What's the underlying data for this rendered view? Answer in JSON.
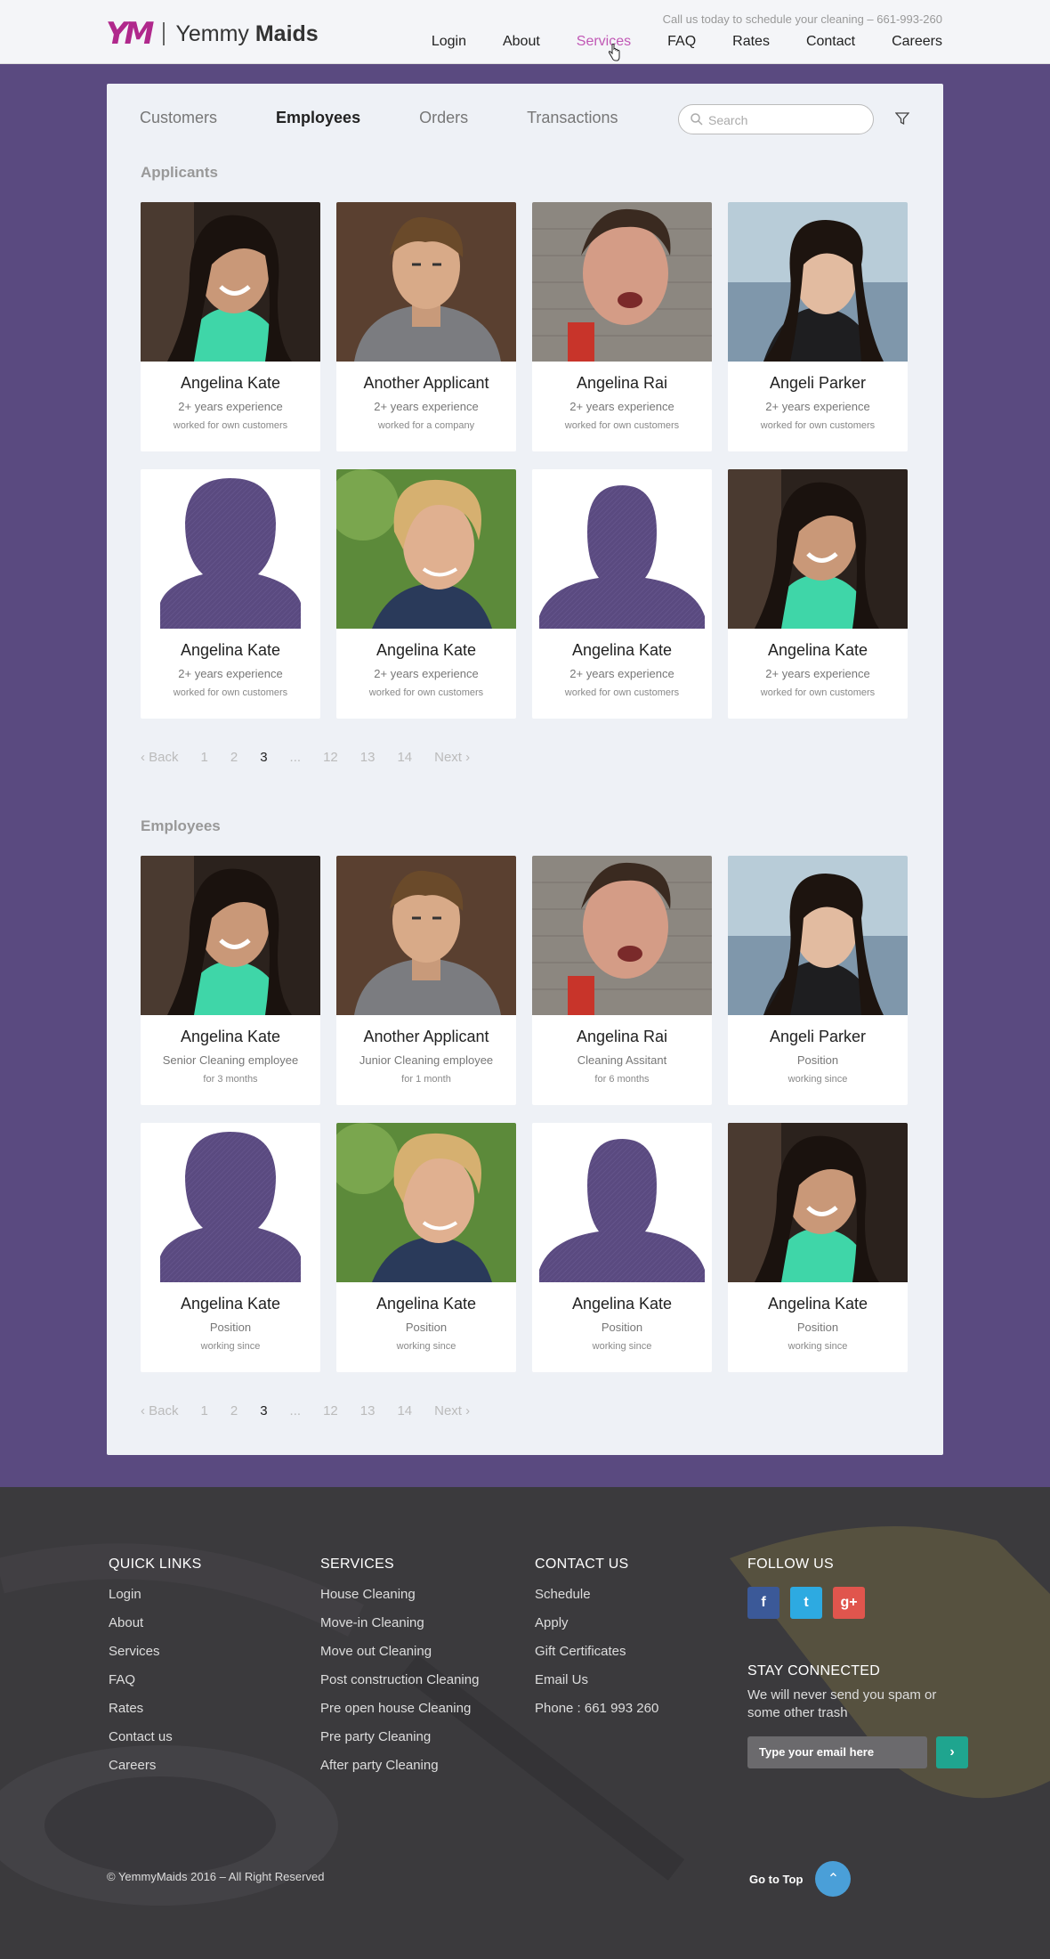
{
  "header": {
    "logo_mark": "YM",
    "logo_text_light": "Yemmy",
    "logo_text_bold": "Maids",
    "callus": "Call us today to schedule your cleaning – 661-993-260",
    "nav": [
      "Login",
      "About",
      "Services",
      "FAQ",
      "Rates",
      "Contact",
      "Careers"
    ],
    "active_nav": "Services"
  },
  "tabs": [
    "Customers",
    "Employees",
    "Orders",
    "Transactions"
  ],
  "active_tab": "Employees",
  "search": {
    "placeholder": "Search"
  },
  "applicants": {
    "title": "Applicants",
    "cards": [
      {
        "name": "Angelina Kate",
        "line1": "2+ years experience",
        "line2": "worked for own customers",
        "photo": "woman-smiling-green-top"
      },
      {
        "name": "Another Applicant",
        "line1": "2+ years experience",
        "line2": "worked for a company",
        "photo": "young-man-grey-hoodie"
      },
      {
        "name": "Angelina Rai",
        "line1": "2+ years experience",
        "line2": "worked for own customers",
        "photo": "woman-brick-wall"
      },
      {
        "name": "Angeli Parker",
        "line1": "2+ years experience",
        "line2": "worked for own customers",
        "photo": "woman-seaside"
      },
      {
        "name": "Angelina Kate",
        "line1": "2+ years experience",
        "line2": "worked for own customers",
        "photo": "female-silhouette"
      },
      {
        "name": "Angelina Kate",
        "line1": "2+ years experience",
        "line2": "worked for own customers",
        "photo": "blond-teen-boy"
      },
      {
        "name": "Angelina Kate",
        "line1": "2+ years experience",
        "line2": "worked for own customers",
        "photo": "male-silhouette"
      },
      {
        "name": "Angelina Kate",
        "line1": "2+ years experience",
        "line2": "worked for own customers",
        "photo": "woman-smiling-green-top"
      }
    ],
    "pager": {
      "back": "Back",
      "pages": [
        "1",
        "2",
        "3",
        "...",
        "12",
        "13",
        "14"
      ],
      "current": "3",
      "next": "Next"
    }
  },
  "employees": {
    "title": "Employees",
    "cards": [
      {
        "name": "Angelina Kate",
        "line1": "Senior Cleaning employee",
        "line2": "for 3 months",
        "photo": "woman-smiling-green-top"
      },
      {
        "name": "Another Applicant",
        "line1": "Junior Cleaning employee",
        "line2": "for 1 month",
        "photo": "young-man-grey-hoodie"
      },
      {
        "name": "Angelina Rai",
        "line1": "Cleaning Assitant",
        "line2": "for 6 months",
        "photo": "woman-brick-wall"
      },
      {
        "name": "Angeli Parker",
        "line1": "Position",
        "line2": "working since",
        "photo": "woman-seaside"
      },
      {
        "name": "Angelina Kate",
        "line1": "Position",
        "line2": "working since",
        "photo": "female-silhouette"
      },
      {
        "name": "Angelina Kate",
        "line1": "Position",
        "line2": "working since",
        "photo": "blond-teen-boy"
      },
      {
        "name": "Angelina Kate",
        "line1": "Position",
        "line2": "working since",
        "photo": "male-silhouette"
      },
      {
        "name": "Angelina Kate",
        "line1": "Position",
        "line2": "working since",
        "photo": "woman-smiling-green-top"
      }
    ],
    "pager": {
      "back": "Back",
      "pages": [
        "1",
        "2",
        "3",
        "...",
        "12",
        "13",
        "14"
      ],
      "current": "3",
      "next": "Next"
    }
  },
  "footer": {
    "quick_links": {
      "title": "QUICK LINKS",
      "items": [
        "Login",
        "About",
        "Services",
        "FAQ",
        "Rates",
        "Contact us",
        "Careers"
      ]
    },
    "services": {
      "title": "SERVICES",
      "items": [
        "House Cleaning",
        "Move-in Cleaning",
        "Move out Cleaning",
        "Post construction Cleaning",
        "Pre open house Cleaning",
        "Pre party Cleaning",
        "After party Cleaning"
      ]
    },
    "contact": {
      "title": "CONTACT US",
      "items": [
        "Schedule",
        "Apply",
        "Gift Certificates",
        "Email Us",
        "Phone : 661 993 260"
      ]
    },
    "follow": {
      "title": "FOLLOW US",
      "icons": [
        {
          "name": "facebook-icon",
          "glyph": "f",
          "color": "#3b5998"
        },
        {
          "name": "twitter-icon",
          "glyph": "t",
          "color": "#2daae1"
        },
        {
          "name": "google-plus-icon",
          "glyph": "g+",
          "color": "#e0554d"
        }
      ]
    },
    "stay": {
      "title": "STAY CONNECTED",
      "text": "We will never send you spam or some other trash",
      "placeholder": "Type your email here"
    },
    "copyright": "© YemmyMaids 2016 – All Right Reserved",
    "go_top": "Go to Top"
  },
  "colors": {
    "accent": "#5a4a80",
    "brand": "#b0288c",
    "active_nav": "#c158b5",
    "teal": "#1fa58f",
    "blue": "#4a9fd8"
  }
}
